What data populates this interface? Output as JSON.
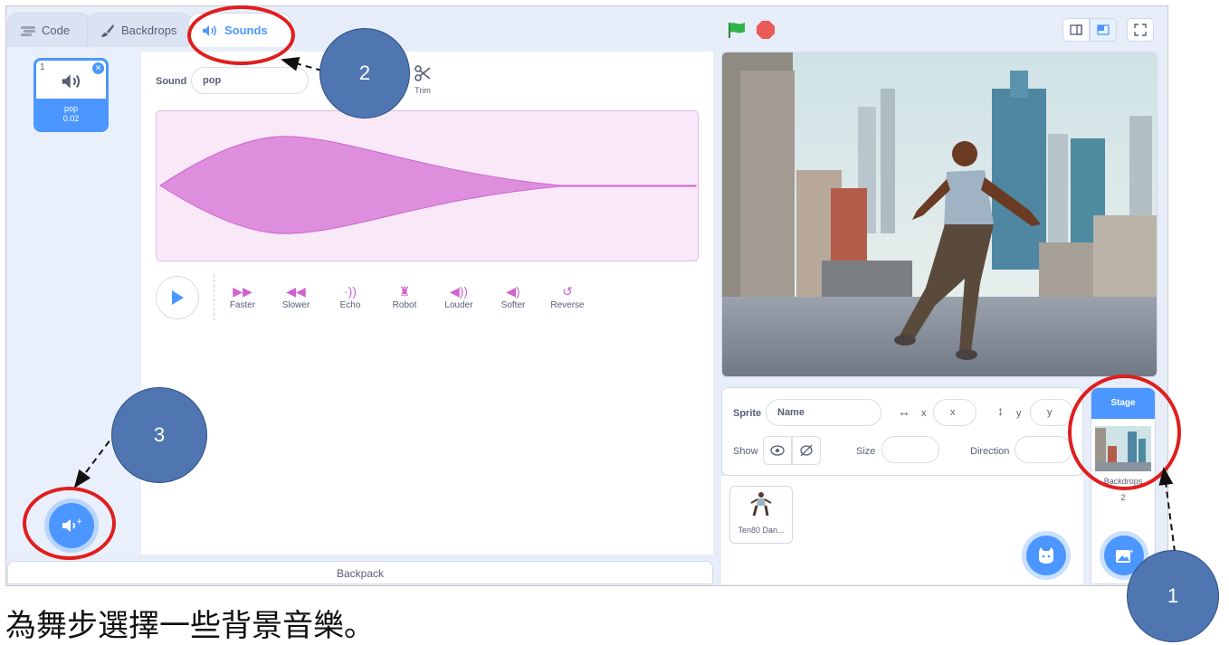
{
  "tabs": {
    "code": "Code",
    "backdrops": "Backdrops",
    "sounds": "Sounds"
  },
  "sound_list": [
    {
      "index": "1",
      "name": "pop",
      "duration": "0.02"
    }
  ],
  "editor": {
    "sound_label": "Sound",
    "sound_name": "pop",
    "trim_label": "Trim",
    "effects": [
      "Faster",
      "Slower",
      "Echo",
      "Robot",
      "Louder",
      "Softer",
      "Reverse"
    ]
  },
  "backpack": {
    "label": "Backpack"
  },
  "sprite_info": {
    "sprite_label": "Sprite",
    "name_placeholder": "Name",
    "x_label": "x",
    "x_placeholder": "x",
    "y_label": "y",
    "y_placeholder": "y",
    "show_label": "Show",
    "size_label": "Size",
    "direction_label": "Direction"
  },
  "sprites": [
    {
      "name": "Ten80 Dan..."
    }
  ],
  "stage_panel": {
    "title": "Stage",
    "backdrops_label": "Backdrops",
    "backdrops_count": "2"
  },
  "annotations": {
    "marker1": "1",
    "marker2": "2",
    "marker3": "3"
  },
  "caption": "為舞步選擇一些背景音樂。",
  "colors": {
    "accent": "#4c97ff",
    "sound_effect": "#cf63cf",
    "annotation_ring": "#e01e1e",
    "annotation_marker": "#4f76b0",
    "stop": "#ec5959",
    "flag": "#2fb34a"
  }
}
